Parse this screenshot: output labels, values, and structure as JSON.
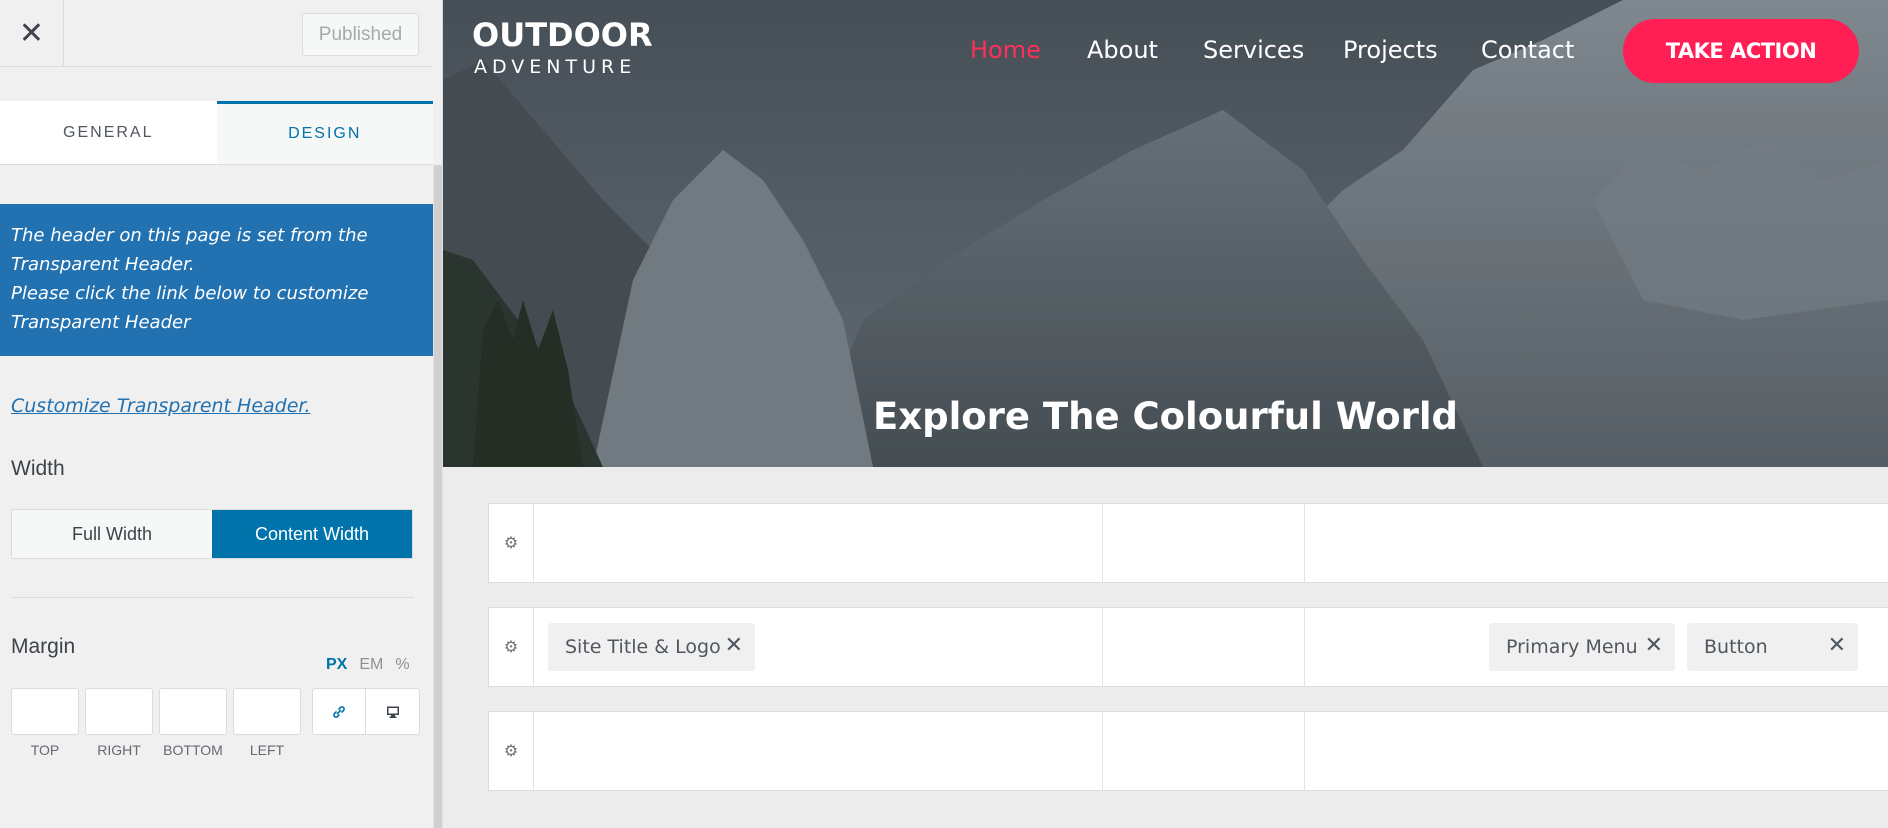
{
  "sidebar": {
    "close_icon": "close-icon",
    "published_label": "Published",
    "tabs": [
      {
        "label": "GENERAL"
      },
      {
        "label": "DESIGN"
      }
    ],
    "notice_line1": "The header on this page is set from the",
    "notice_line2": "Transparent Header.",
    "notice_line3": "Please click the link below to customize",
    "notice_line4": "Transparent Header",
    "customize_link": "Customize Transparent Header.",
    "width_label": "Width",
    "width_options": {
      "full": "Full Width",
      "content": "Content Width",
      "selected": "Content Width"
    },
    "margin_label": "Margin",
    "units": [
      "PX",
      "EM",
      "%"
    ],
    "margin_captions": [
      "TOP",
      "RIGHT",
      "BOTTOM",
      "LEFT"
    ],
    "accent_color": "#0073aa",
    "notice_color": "#2271b1"
  },
  "preview": {
    "logo_title": "OUTDOOR",
    "logo_subtitle": "ADVENTURE",
    "nav": {
      "home": "Home",
      "about": "About",
      "services": "Services",
      "projects": "Projects",
      "contact": "Contact"
    },
    "cta_label": "TAKE ACTION",
    "hero_heading": "Explore The Colourful World",
    "active_nav_color": "#ff2f5b",
    "cta_color": "#ff1f55",
    "builder_rows": [
      {
        "items_left": [],
        "items_right": []
      },
      {
        "items_left": [
          {
            "label": "Site Title & Logo"
          }
        ],
        "items_right": [
          {
            "label": "Primary Menu"
          },
          {
            "label": "Button"
          }
        ]
      },
      {
        "items_left": [],
        "items_right": []
      }
    ]
  }
}
